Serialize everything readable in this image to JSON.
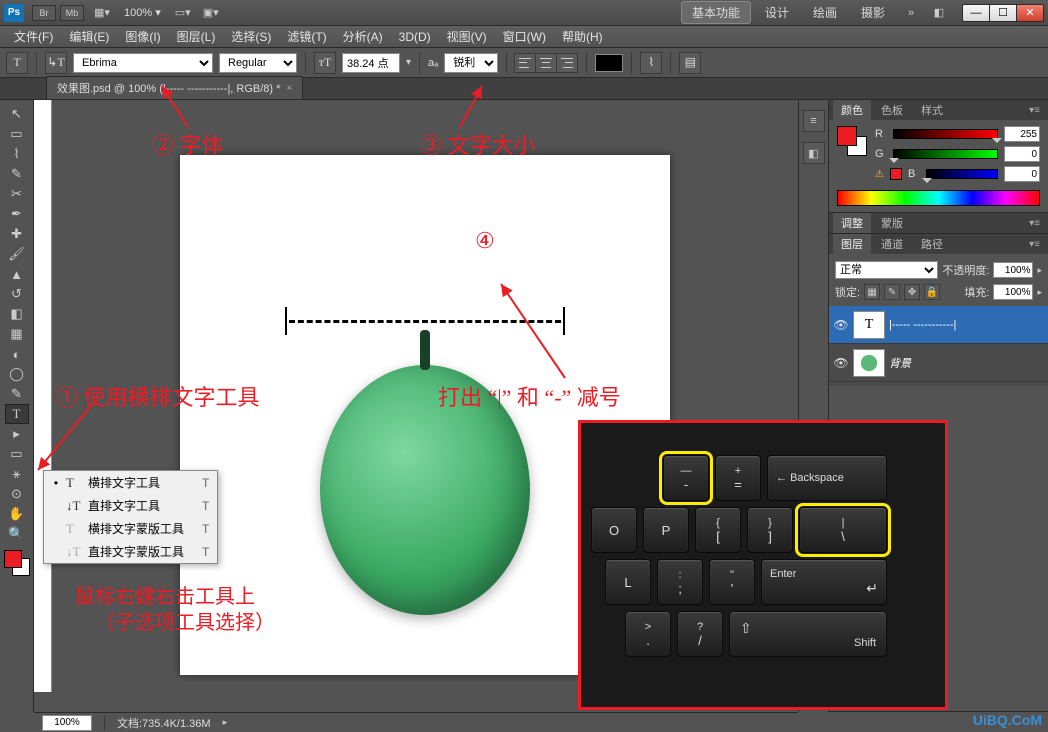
{
  "titlebar": {
    "logo": "Ps",
    "btn_br": "Br",
    "btn_mb": "Mb",
    "zoom": "100%",
    "workspaces": [
      "基本功能",
      "设计",
      "绘画",
      "摄影"
    ],
    "win": {
      "min": "—",
      "max": "☐",
      "close": "✕"
    }
  },
  "menu": [
    "文件(F)",
    "编辑(E)",
    "图像(I)",
    "图层(L)",
    "选择(S)",
    "滤镜(T)",
    "分析(A)",
    "3D(D)",
    "视图(V)",
    "窗口(W)",
    "帮助(H)"
  ],
  "optbar": {
    "tool_glyph": "T",
    "font": "Ebrima",
    "style": "Regular",
    "size": "38.24 点",
    "aa_icon": "aₐ",
    "aa": "锐利"
  },
  "doc_tab": {
    "title": "效果图.psd @ 100% (|-----  -----------|, RGB/8) *",
    "close": "×"
  },
  "panels": {
    "color": {
      "tabs": [
        "颜色",
        "色板",
        "样式"
      ],
      "r_lbl": "R",
      "g_lbl": "G",
      "b_lbl": "B",
      "r": "255",
      "g": "0",
      "b": "0",
      "warn": "⚠"
    },
    "adjust": {
      "tabs": [
        "调整",
        "蒙版"
      ]
    },
    "layers": {
      "tabs": [
        "图层",
        "通道",
        "路径"
      ],
      "blend": "正常",
      "opacity_lbl": "不透明度:",
      "opacity": "100%",
      "lock_lbl": "锁定:",
      "fill_lbl": "填充:",
      "fill": "100%",
      "layer1_thumb": "T",
      "layer1_name": "|-----  -----------|",
      "layer2_name": "背景"
    }
  },
  "flyout": {
    "items": [
      {
        "dot": "•",
        "icon": "T",
        "label": "横排文字工具",
        "sc": "T"
      },
      {
        "dot": "",
        "icon": "↓T",
        "label": "直排文字工具",
        "sc": "T"
      },
      {
        "dot": "",
        "icon": "T",
        "label": "横排文字蒙版工具",
        "sc": "T"
      },
      {
        "dot": "",
        "icon": "↓T",
        "label": "直排文字蒙版工具",
        "sc": "T"
      }
    ]
  },
  "annot": {
    "a1": "① 使用横排文字工具",
    "a2": "② 字体",
    "a3": "③ 文字大小",
    "a4": "④",
    "a4b": "打出 “|” 和 “-” 减号",
    "a5": "鼠标右健右击工具上",
    "a6": "（子选项工具选择）"
  },
  "keyboard": {
    "keys": {
      "minus_top": "—",
      "minus": "-",
      "plus_top": "+",
      "plus": "=",
      "backspace": "Backspace",
      "bs_arrow": "←",
      "o": "O",
      "p": "P",
      "lb_top": "{",
      "lb": "[",
      "rb_top": "}",
      "rb": "]",
      "pipe_top": "|",
      "pipe": "\\",
      "l": "L",
      "semi_top": ":",
      "semi": ";",
      "quote_top": "\"",
      "quote": "'",
      "enter": "Enter",
      "enter_ic": "↵",
      "dot_top": ">",
      "dot": ".",
      "slash_top": "?",
      "slash": "/",
      "shift": "Shift",
      "shift_ic": "⇧"
    }
  },
  "statusbar": {
    "zoom": "100%",
    "doc": "文档:735.4K/1.36M"
  },
  "watermark": "UiBQ.CoM"
}
